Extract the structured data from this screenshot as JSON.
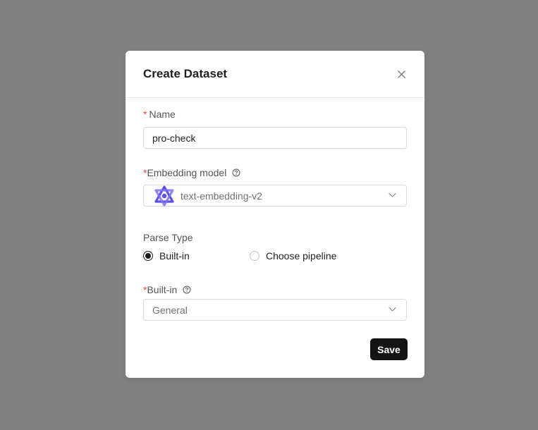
{
  "dialog": {
    "title": "Create Dataset",
    "close_icon": "close-icon"
  },
  "name_field": {
    "required_mark": "*",
    "label": "Name",
    "value": "pro-check"
  },
  "embedding_field": {
    "required_mark": "*",
    "label": "Embedding model",
    "help_icon": "help-circle-icon",
    "provider_icon": "qwen-logo-icon",
    "value": "text-embedding-v2",
    "dropdown_icon": "chevron-down-icon"
  },
  "parse_type": {
    "label": "Parse Type",
    "options": [
      {
        "label": "Built-in",
        "selected": true
      },
      {
        "label": "Choose pipeline",
        "selected": false
      }
    ]
  },
  "builtin_field": {
    "required_mark": "*",
    "label": "Built-in",
    "help_icon": "help-circle-icon",
    "value": "General",
    "dropdown_icon": "chevron-down-icon"
  },
  "actions": {
    "save_label": "Save"
  },
  "colors": {
    "overlay": "#808080",
    "required": "#e5484d",
    "primary_button": "#141414",
    "logo": "#5b4fe9"
  }
}
